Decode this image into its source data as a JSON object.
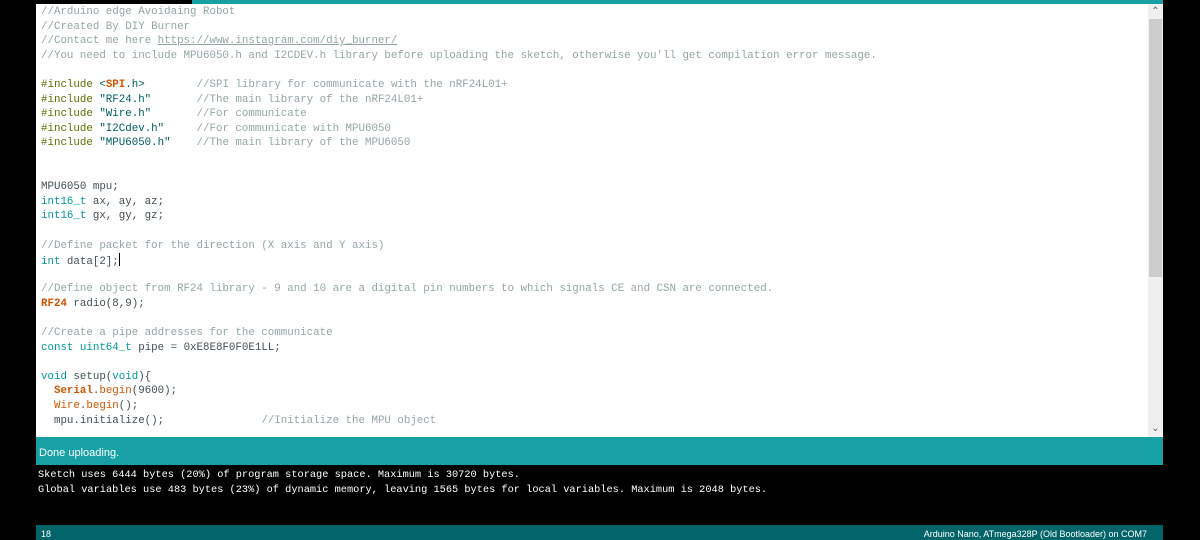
{
  "colors": {
    "accent": "#17a1a5",
    "footer": "#006468",
    "comment": "#95a5a6",
    "keyword": "#00979c",
    "preprocessor": "#5e6d03",
    "string": "#005c5f",
    "class": "#d35400"
  },
  "code": {
    "cursor_line": 18,
    "lines": [
      {
        "tokens": [
          {
            "t": "//Arduino edge Avoidaing Robot",
            "c": "comment"
          }
        ]
      },
      {
        "tokens": [
          {
            "t": "//Created By DIY Burner",
            "c": "comment"
          }
        ]
      },
      {
        "tokens": [
          {
            "t": "//Contact me here ",
            "c": "comment"
          },
          {
            "t": "https://www.instagram.com/diy_burner/",
            "c": "link"
          }
        ]
      },
      {
        "tokens": [
          {
            "t": "//You need to include MPU6050.h and I2CDEV.h library before uploading the sketch, otherwise you'll get compilation error message.",
            "c": "comment"
          }
        ]
      },
      {
        "tokens": []
      },
      {
        "tokens": [
          {
            "t": "#include",
            "c": "pre"
          },
          {
            "t": " <",
            "c": "str"
          },
          {
            "t": "SPI",
            "c": "cls"
          },
          {
            "t": ".h>",
            "c": "str"
          },
          {
            "t": "        ",
            "c": ""
          },
          {
            "t": "//SPI library for communicate with the nRF24L01+",
            "c": "comment"
          }
        ]
      },
      {
        "tokens": [
          {
            "t": "#include",
            "c": "pre"
          },
          {
            "t": " \"RF24.h\"",
            "c": "str"
          },
          {
            "t": "       ",
            "c": ""
          },
          {
            "t": "//The main library of the nRF24L01+",
            "c": "comment"
          }
        ]
      },
      {
        "tokens": [
          {
            "t": "#include",
            "c": "pre"
          },
          {
            "t": " \"Wire.h\"",
            "c": "str"
          },
          {
            "t": "       ",
            "c": ""
          },
          {
            "t": "//For communicate",
            "c": "comment"
          }
        ]
      },
      {
        "tokens": [
          {
            "t": "#include",
            "c": "pre"
          },
          {
            "t": " \"I2Cdev.h\"",
            "c": "str"
          },
          {
            "t": "     ",
            "c": ""
          },
          {
            "t": "//For communicate with MPU6050",
            "c": "comment"
          }
        ]
      },
      {
        "tokens": [
          {
            "t": "#include",
            "c": "pre"
          },
          {
            "t": " \"MPU6050.h\"",
            "c": "str"
          },
          {
            "t": "    ",
            "c": ""
          },
          {
            "t": "//The main library of the MPU6050",
            "c": "comment"
          }
        ]
      },
      {
        "tokens": []
      },
      {
        "tokens": []
      },
      {
        "tokens": [
          {
            "t": "MPU6050 mpu;",
            "c": ""
          }
        ]
      },
      {
        "tokens": [
          {
            "t": "int16_t",
            "c": "kw"
          },
          {
            "t": " ax, ay, az;",
            "c": ""
          }
        ]
      },
      {
        "tokens": [
          {
            "t": "int16_t",
            "c": "kw"
          },
          {
            "t": " gx, gy, gz;",
            "c": ""
          }
        ]
      },
      {
        "tokens": []
      },
      {
        "tokens": [
          {
            "t": "//Define packet for the direction (X axis and Y axis)",
            "c": "comment"
          }
        ]
      },
      {
        "tokens": [
          {
            "t": "int",
            "c": "kw"
          },
          {
            "t": " data[2];",
            "c": ""
          }
        ]
      },
      {
        "tokens": []
      },
      {
        "tokens": [
          {
            "t": "//Define object from RF24 library - 9 and 10 are a digital pin numbers to which signals CE and CSN are connected.",
            "c": "comment"
          }
        ]
      },
      {
        "tokens": [
          {
            "t": "RF24",
            "c": "cls"
          },
          {
            "t": " radio(8,9);",
            "c": ""
          }
        ]
      },
      {
        "tokens": []
      },
      {
        "tokens": [
          {
            "t": "//Create a pipe addresses for the communicate",
            "c": "comment"
          }
        ]
      },
      {
        "tokens": [
          {
            "t": "const",
            "c": "kw"
          },
          {
            "t": " ",
            "c": ""
          },
          {
            "t": "uint64_t",
            "c": "kw"
          },
          {
            "t": " pipe = 0xE8E8F0F0E1LL;",
            "c": ""
          }
        ]
      },
      {
        "tokens": []
      },
      {
        "tokens": [
          {
            "t": "void",
            "c": "kw"
          },
          {
            "t": " setup(",
            "c": ""
          },
          {
            "t": "void",
            "c": "kw"
          },
          {
            "t": "){",
            "c": ""
          }
        ]
      },
      {
        "tokens": [
          {
            "t": "  ",
            "c": ""
          },
          {
            "t": "Serial",
            "c": "cls"
          },
          {
            "t": ".",
            "c": ""
          },
          {
            "t": "begin",
            "c": "fn"
          },
          {
            "t": "(9600);",
            "c": ""
          }
        ]
      },
      {
        "tokens": [
          {
            "t": "  ",
            "c": ""
          },
          {
            "t": "Wire",
            "c": "fn"
          },
          {
            "t": ".",
            "c": ""
          },
          {
            "t": "begin",
            "c": "fn"
          },
          {
            "t": "();",
            "c": ""
          }
        ]
      },
      {
        "tokens": [
          {
            "t": "  mpu.initialize();",
            "c": ""
          },
          {
            "t": "               ",
            "c": ""
          },
          {
            "t": "//Initialize the MPU object",
            "c": "comment"
          }
        ]
      }
    ]
  },
  "scrollbar": {
    "up_icon": "chevron-up-icon",
    "down_icon": "chevron-down-icon"
  },
  "status": {
    "message": "Done uploading."
  },
  "console": {
    "lines": [
      "Sketch uses 6444 bytes (20%) of program storage space. Maximum is 30720 bytes.",
      "Global variables use 483 bytes (23%) of dynamic memory, leaving 1565 bytes for local variables. Maximum is 2048 bytes."
    ]
  },
  "footer": {
    "line_number": "18",
    "board": "Arduino Nano, ATmega328P (Old Bootloader) on COM7"
  }
}
